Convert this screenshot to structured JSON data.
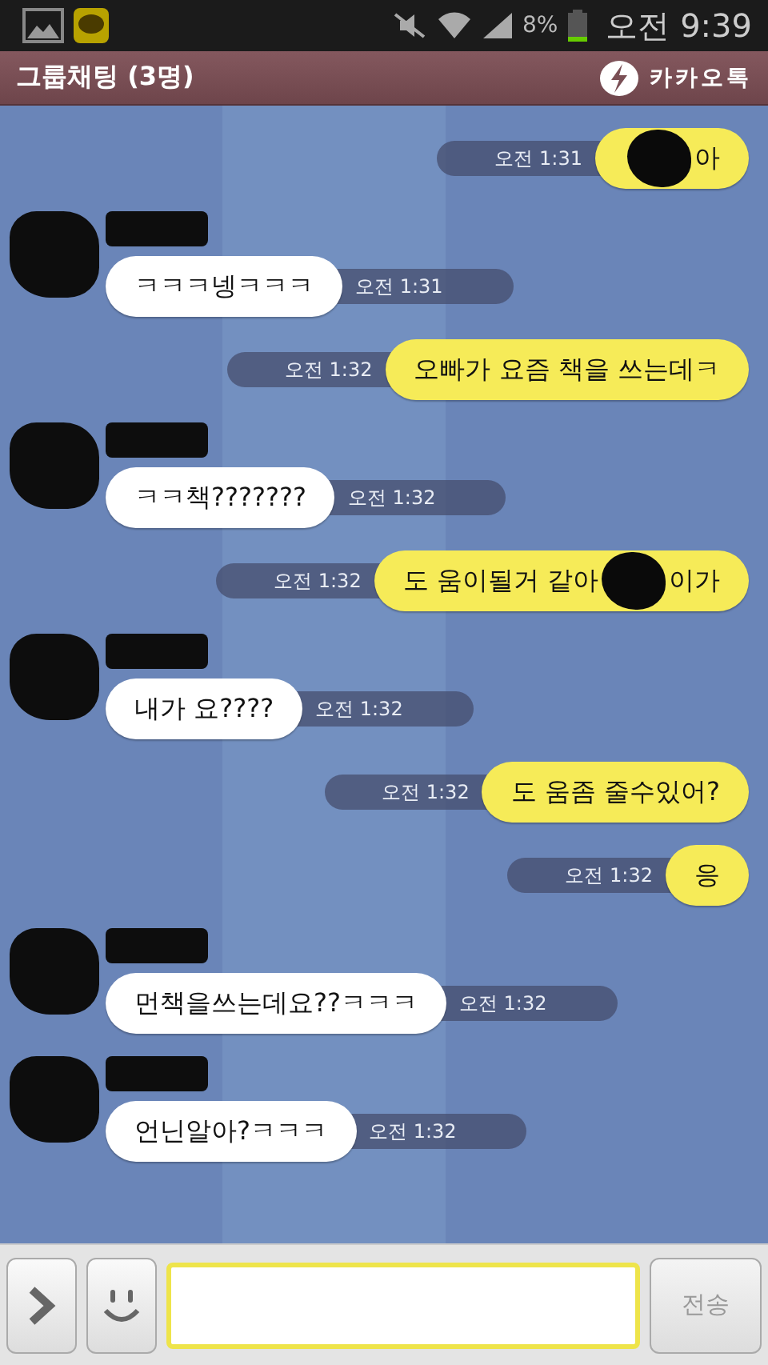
{
  "status_bar": {
    "battery": "8%",
    "time": "오전 9:39"
  },
  "header": {
    "title": "그룹채팅 (3명)",
    "brand": "카카오톡"
  },
  "messages": [
    {
      "kind": "sent",
      "time": "오전 1:31",
      "pieces": [
        {
          "kind": "redaction"
        },
        {
          "kind": "text",
          "text": "아"
        }
      ]
    },
    {
      "kind": "received",
      "time": "오전 1:31",
      "pieces": [
        {
          "kind": "text",
          "text": "ㅋㅋㅋ넹ㅋㅋㅋ"
        }
      ]
    },
    {
      "kind": "sent",
      "time": "오전 1:32",
      "pieces": [
        {
          "kind": "text",
          "text": "오빠가 요즘 책을 쓰는데ㅋ"
        }
      ]
    },
    {
      "kind": "received",
      "time": "오전 1:32",
      "pieces": [
        {
          "kind": "text",
          "text": "ㅋㅋ책???????"
        }
      ]
    },
    {
      "kind": "sent",
      "time": "오전 1:32",
      "pieces": [
        {
          "kind": "text",
          "text": "도 움이될거 같아"
        },
        {
          "kind": "redaction"
        },
        {
          "kind": "text",
          "text": "이가"
        }
      ]
    },
    {
      "kind": "received",
      "time": "오전 1:32",
      "pieces": [
        {
          "kind": "text",
          "text": "내가 요????"
        }
      ]
    },
    {
      "kind": "sent",
      "time": "오전 1:32",
      "pieces": [
        {
          "kind": "text",
          "text": "도 움좀 줄수있어?"
        }
      ]
    },
    {
      "kind": "sent",
      "time": "오전 1:32",
      "pieces": [
        {
          "kind": "text",
          "text": "응"
        }
      ]
    },
    {
      "kind": "received",
      "time": "오전 1:32",
      "pieces": [
        {
          "kind": "text",
          "text": "먼책을쓰는데요??ㅋㅋㅋ"
        }
      ]
    },
    {
      "kind": "received",
      "time": "오전 1:32",
      "pieces": [
        {
          "kind": "text",
          "text": "언닌알아?ㅋㅋㅋ"
        }
      ]
    }
  ],
  "composer": {
    "send_label": "전송"
  }
}
